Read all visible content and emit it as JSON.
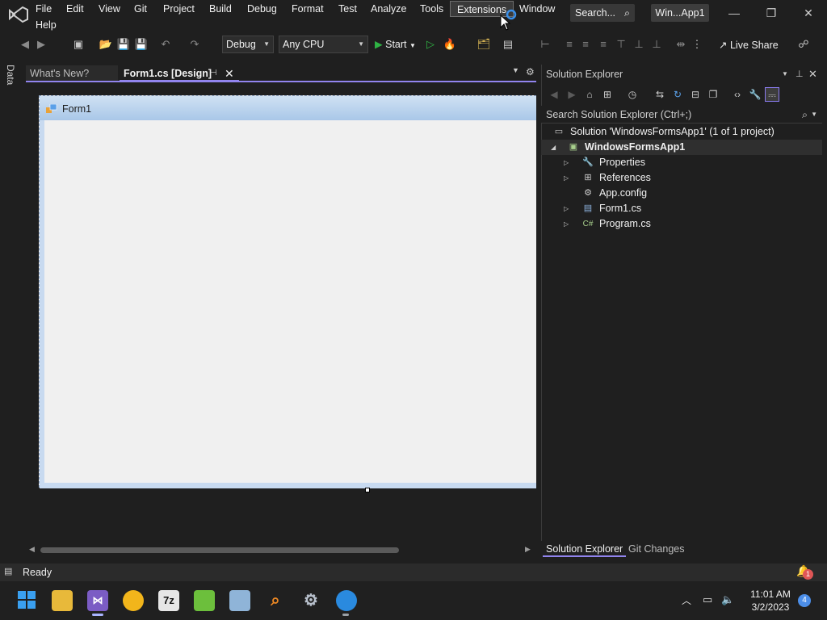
{
  "menu": {
    "file": "File",
    "edit": "Edit",
    "view": "View",
    "git": "Git",
    "project": "Project",
    "build": "Build",
    "debug": "Debug",
    "format": "Format",
    "test": "Test",
    "analyze": "Analyze",
    "tools": "Tools",
    "extensions": "Extensions",
    "window": "Window",
    "help": "Help"
  },
  "title": {
    "search": "Search...",
    "solution_badge": "Win...App1"
  },
  "toolbar": {
    "configuration": "Debug",
    "platform": "Any CPU",
    "start_label": "Start",
    "live_share_label": "Live Share"
  },
  "side_tabs": {
    "data_sources": "Data Sources"
  },
  "doc_tabs": {
    "whats_new": "What's New?",
    "form1_design": "Form1.cs [Design]"
  },
  "designer": {
    "form_title": "Form1"
  },
  "solution_explorer": {
    "title": "Solution Explorer",
    "search_placeholder": "Search Solution Explorer (Ctrl+;)",
    "tree": [
      {
        "label": "Solution 'WindowsFormsApp1' (1 of 1 project)"
      },
      {
        "label": "WindowsFormsApp1"
      },
      {
        "label": "Properties"
      },
      {
        "label": "References"
      },
      {
        "label": "App.config"
      },
      {
        "label": "Form1.cs"
      },
      {
        "label": "Program.cs"
      }
    ],
    "bottom_tabs": {
      "solution_explorer": "Solution Explorer",
      "git_changes": "Git Changes"
    }
  },
  "status": {
    "text": "Ready",
    "notification_count": "1"
  },
  "taskbar": {
    "time": "11:01 AM",
    "date": "3/2/2023",
    "notification_count": "4",
    "seven_zip_label": "7z"
  },
  "colors": {
    "accent": "#9184ee",
    "background": "#1f1f1f",
    "form_surface": "#f0f0f0"
  }
}
